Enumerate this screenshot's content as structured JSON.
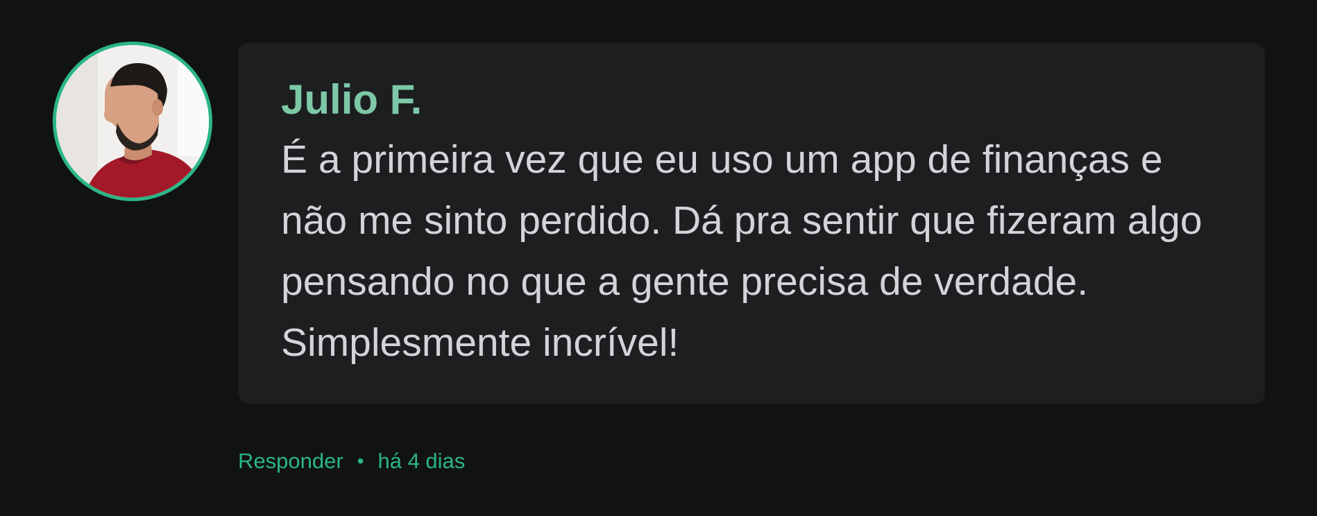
{
  "comment": {
    "author": "Julio F.",
    "text": "É a primeira vez que eu uso um app de finanças e não me sinto perdido. Dá pra sentir que fizeram algo pensando no que a gente precisa de verdade. Simplesmente incrível!",
    "reply_label": "Responder",
    "separator": "•",
    "timestamp": "há 4 dias"
  },
  "colors": {
    "background": "#111214",
    "bubble": "#1d1e20",
    "author": "#7cc8a7",
    "text": "#d2d4d8",
    "accent": "#2bb685"
  }
}
